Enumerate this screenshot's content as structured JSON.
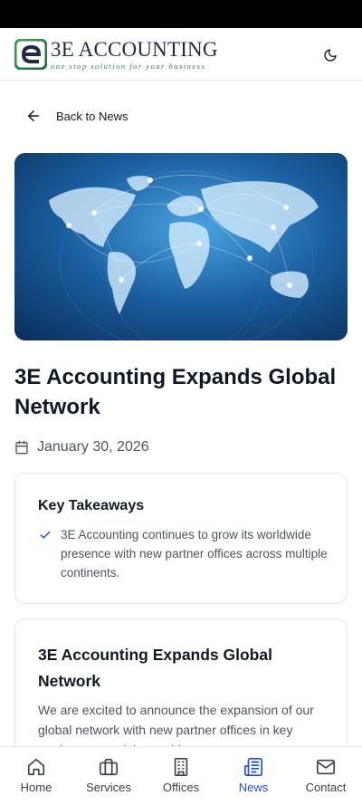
{
  "header": {
    "brand_name": "3E ACCOUNTING",
    "brand_tagline": "one stop solution for your business",
    "theme_icon": "moon-icon"
  },
  "back_link": {
    "label": "Back to News",
    "icon": "arrow-left-icon"
  },
  "article": {
    "title": "3E Accounting Expands Global Network",
    "date": "January 30, 2026",
    "date_icon": "calendar-icon"
  },
  "takeaways": {
    "heading": "Key Takeaways",
    "items": [
      "3E Accounting continues to grow its worldwide presence with new partner offices across multiple continents."
    ]
  },
  "content": {
    "heading": "3E Accounting Expands Global Network",
    "body": "We are excited to announce the expansion of our global network with new partner offices in key markets around the world."
  },
  "nav": {
    "items": [
      {
        "label": "Home",
        "icon": "home-icon",
        "active": false
      },
      {
        "label": "Services",
        "icon": "briefcase-icon",
        "active": false
      },
      {
        "label": "Offices",
        "icon": "building-icon",
        "active": false
      },
      {
        "label": "News",
        "icon": "newspaper-icon",
        "active": true
      },
      {
        "label": "Contact",
        "icon": "mail-icon",
        "active": false
      }
    ]
  },
  "colors": {
    "accent": "#1d4ed8",
    "brand_green": "#2e7d4f",
    "brand_navy": "#1f2a44"
  }
}
